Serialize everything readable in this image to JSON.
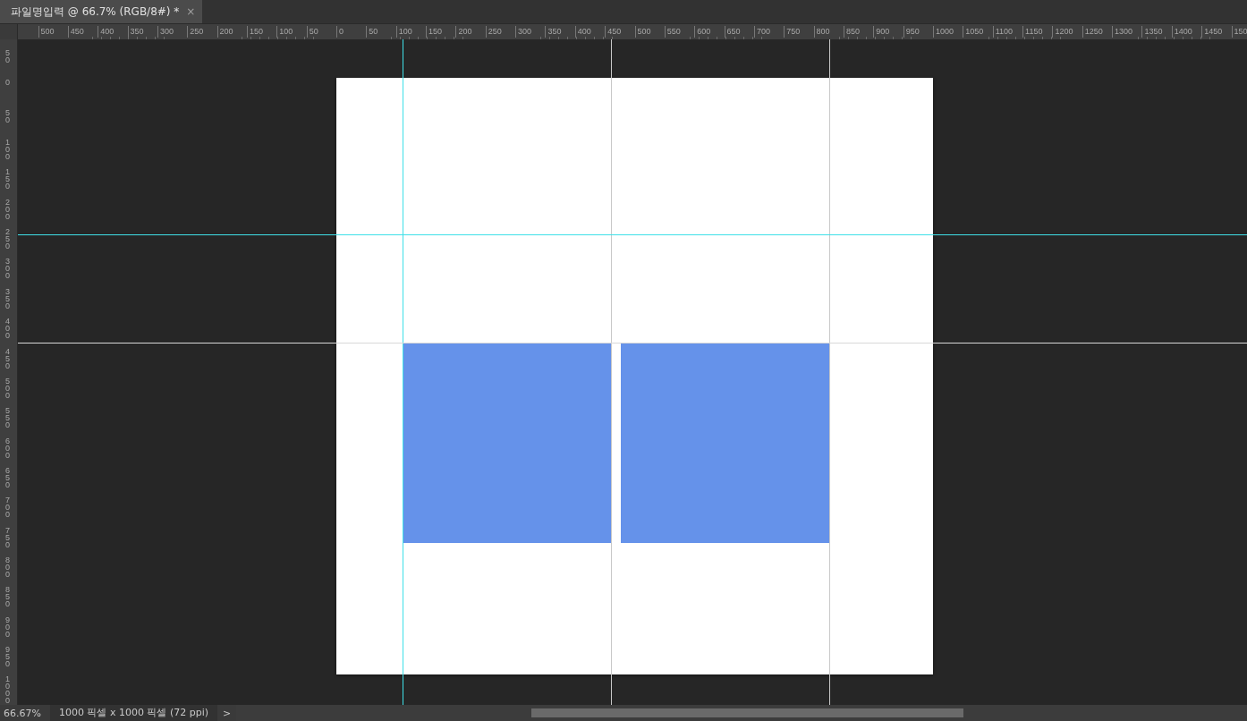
{
  "tabs": [
    {
      "title": "파일명입력 @ 66.7% (RGB/8#) *",
      "close": "×",
      "selected": true
    }
  ],
  "top_ruler": [
    "500",
    "450",
    "400",
    "350",
    "300",
    "250",
    "200",
    "150",
    "100",
    "50",
    "0",
    "50",
    "100",
    "150",
    "200",
    "250",
    "300",
    "350",
    "400",
    "450",
    "500",
    "550",
    "600",
    "650",
    "700",
    "750",
    "800",
    "850",
    "900",
    "950",
    "1000",
    "1050",
    "1100",
    "1150",
    "1200",
    "1250",
    "1300",
    "1350",
    "1400",
    "1450",
    "150"
  ],
  "left_ruler": [
    "50",
    "0",
    "50",
    "100",
    "150",
    "200",
    "250",
    "300",
    "350",
    "400",
    "450",
    "500",
    "550",
    "600",
    "650",
    "700",
    "750",
    "800",
    "850",
    "900",
    "950",
    "1000"
  ],
  "status_bar": {
    "zoom": "66.67%",
    "document_info": "1000 픽셀 x 1000 픽셀 (72 ppi)",
    "arrow": ">"
  }
}
